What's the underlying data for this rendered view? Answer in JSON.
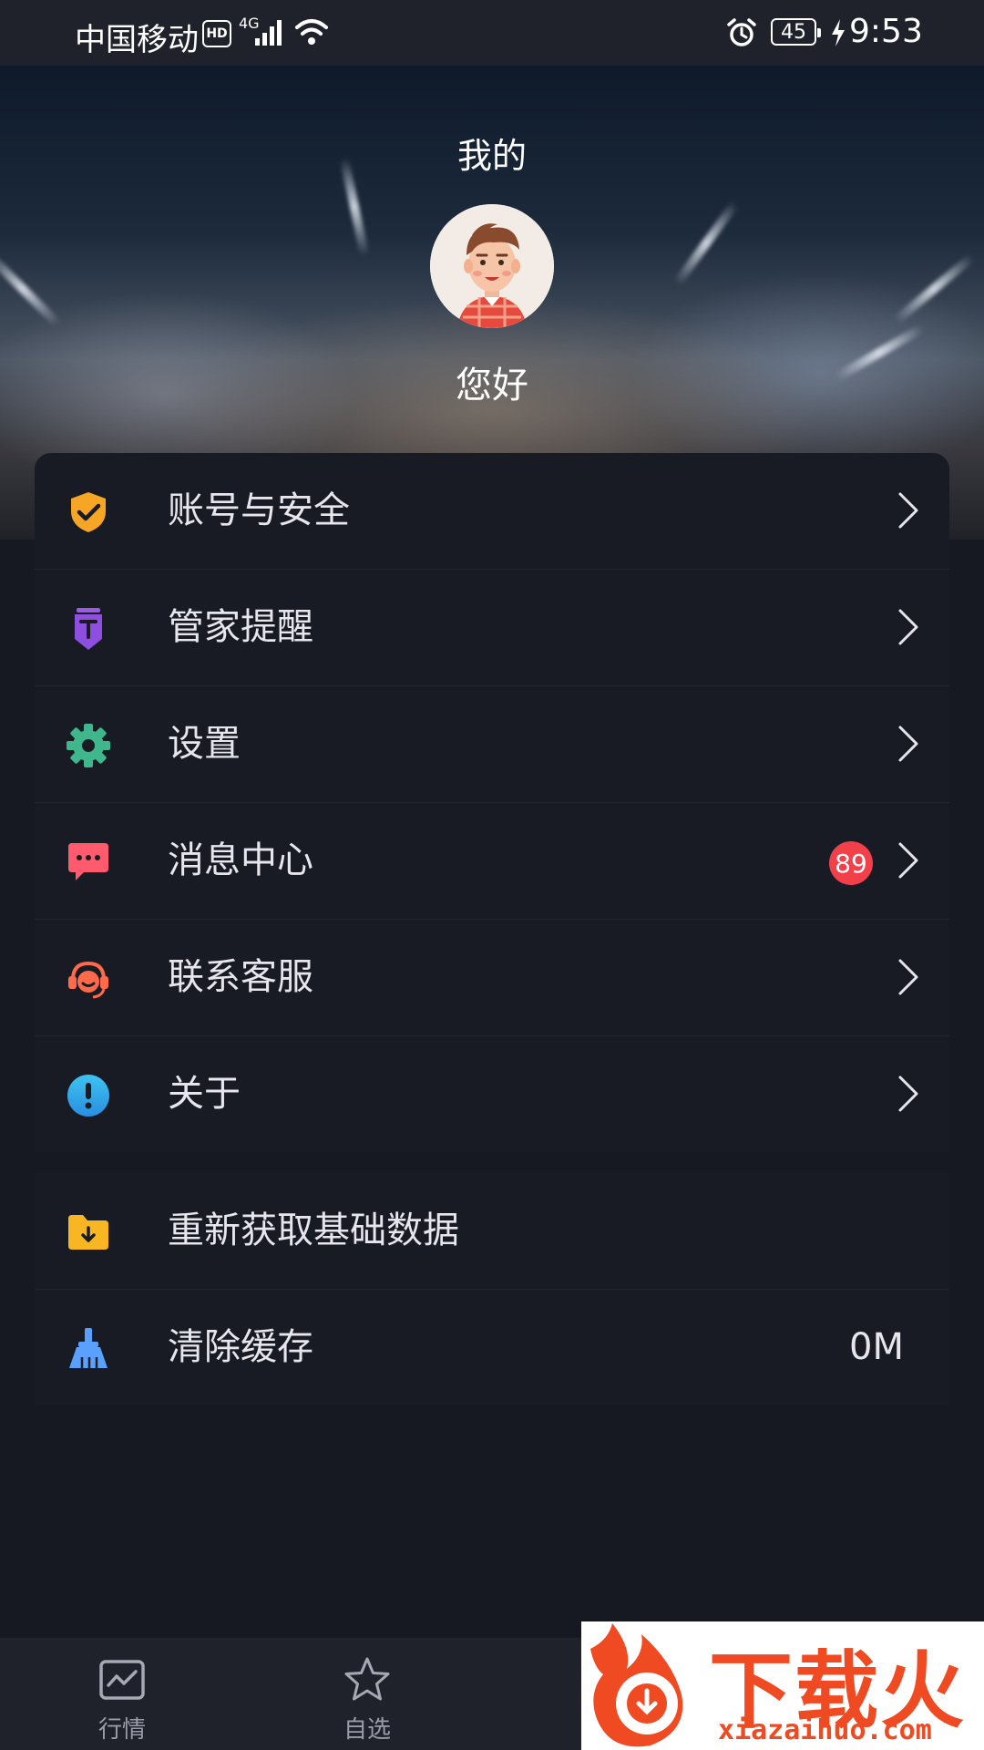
{
  "status_bar": {
    "carrier": "中国移动",
    "hd": "HD",
    "network": "4G",
    "battery": "45",
    "time": "9:53"
  },
  "header": {
    "title": "我的",
    "greeting": "您好"
  },
  "menu": {
    "items": [
      {
        "label": "账号与安全",
        "icon": "shield-check-icon"
      },
      {
        "label": "管家提醒",
        "icon": "reminder-tag-icon"
      },
      {
        "label": "设置",
        "icon": "gear-icon"
      },
      {
        "label": "消息中心",
        "icon": "message-icon",
        "badge": "89"
      },
      {
        "label": "联系客服",
        "icon": "headset-icon"
      },
      {
        "label": "关于",
        "icon": "info-icon"
      }
    ],
    "extra_items": [
      {
        "label": "重新获取基础数据",
        "icon": "folder-download-icon"
      },
      {
        "label": "清除缓存",
        "icon": "broom-icon",
        "value": "0M"
      }
    ]
  },
  "bottom_nav": {
    "items": [
      {
        "label": "行情",
        "icon": "market-chart-icon"
      },
      {
        "label": "自选",
        "icon": "star-icon"
      }
    ]
  },
  "watermark": {
    "text": "下载火",
    "url": "xiazaihuo.com"
  },
  "colors": {
    "background": "#171922",
    "card": "#181a24",
    "badge": "#f2404a",
    "shield": "#f6a524",
    "gear": "#3fb68c",
    "message": "#ff5a6e",
    "headset": "#ff6a4a",
    "info": "#2fa9e6",
    "folder": "#f8b622",
    "broom": "#5aa0ff"
  }
}
